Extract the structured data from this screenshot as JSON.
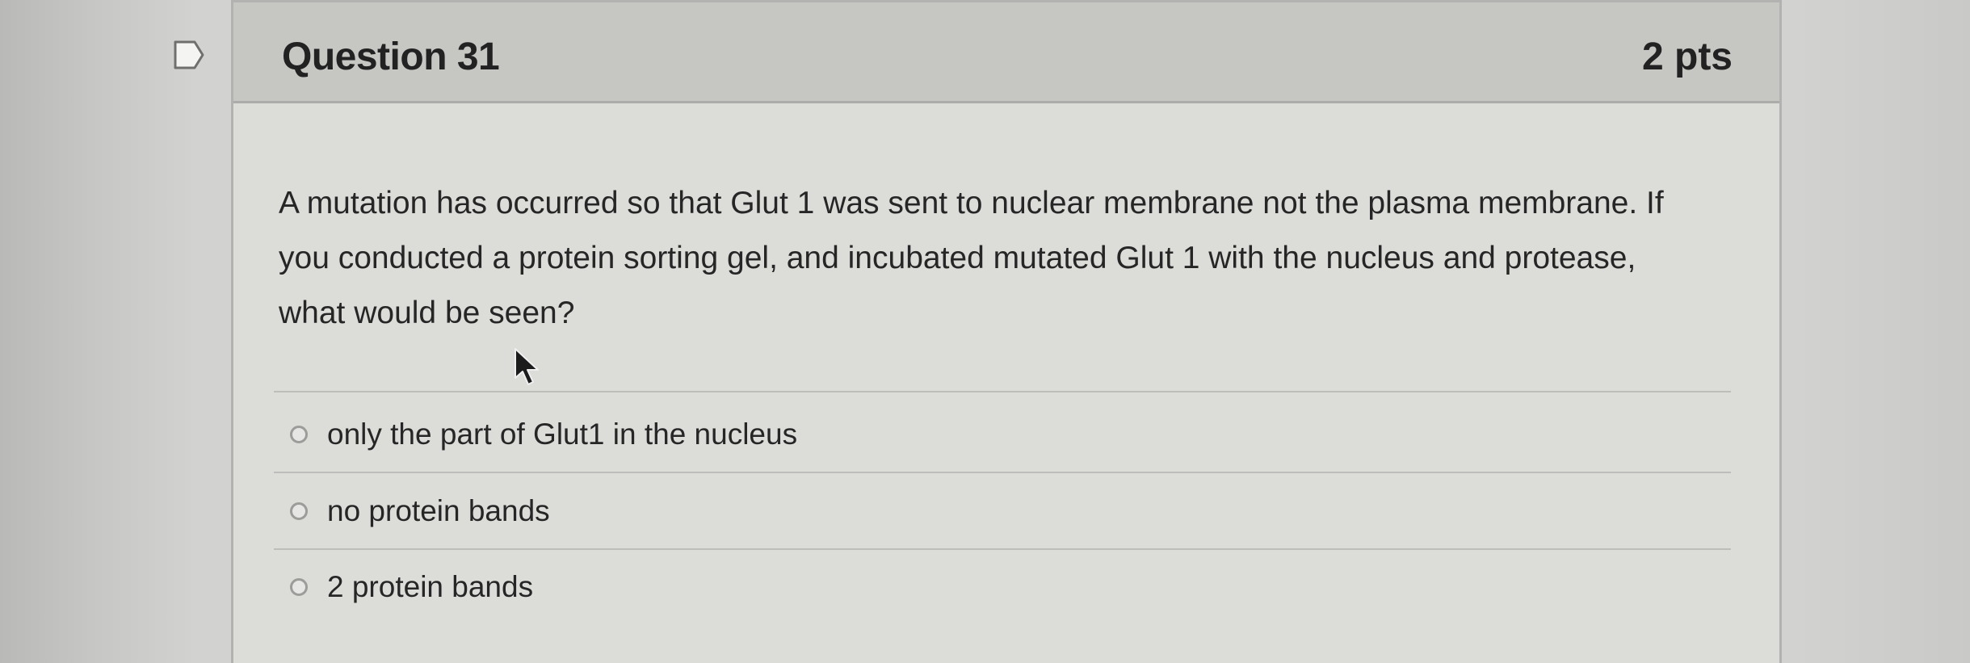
{
  "question": {
    "title": "Question 31",
    "points": "2 pts",
    "text": "A mutation has occurred so that Glut 1 was sent to nuclear membrane not the plasma membrane. If you conducted a protein sorting gel,  and incubated mutated Glut 1 with the nucleus and protease, what would be seen?"
  },
  "answers": [
    {
      "label": "only the part of Glut1 in the nucleus",
      "selected": false
    },
    {
      "label": "no protein bands",
      "selected": false
    },
    {
      "label": "2 protein bands",
      "selected": false
    }
  ],
  "icons": {
    "bookmark": "bookmark-icon",
    "cursor": "mouse-cursor-icon"
  }
}
